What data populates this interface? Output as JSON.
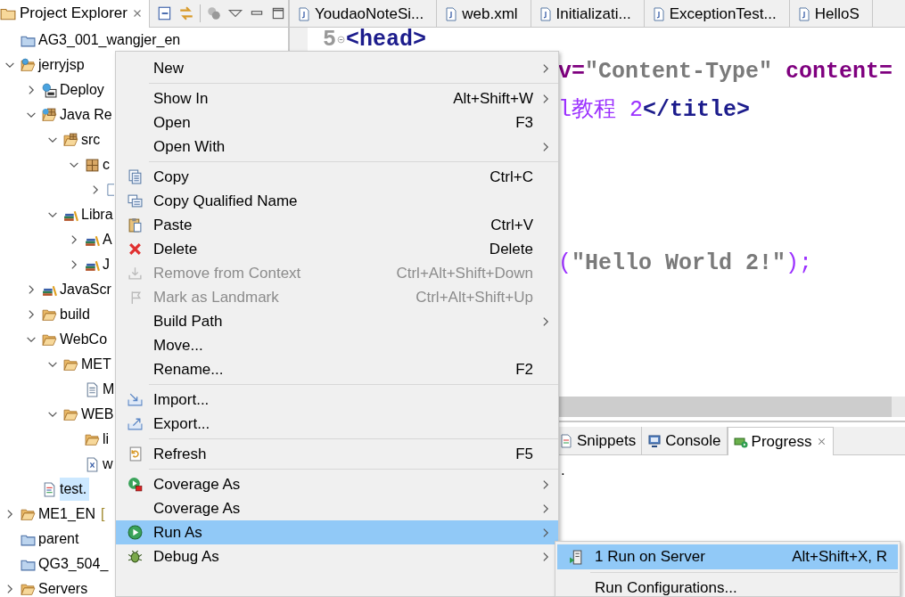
{
  "explorer": {
    "title": "Project Explorer",
    "tree": [
      {
        "label": "AG3_001_wangjer_en",
        "kind": "project",
        "selected": false
      },
      {
        "label": "jerryjsp",
        "kind": "web-project",
        "expanded": true,
        "selected": false,
        "children": [
          {
            "label": "Deploy",
            "kind": "deploy",
            "expanded": false,
            "selected": false
          },
          {
            "label": "Java Re",
            "kind": "resources",
            "expanded": true,
            "selected": false,
            "children": [
              {
                "label": "src",
                "kind": "source",
                "expanded": true,
                "selected": false,
                "children": [
                  {
                    "label": "c",
                    "kind": "package",
                    "expanded": true,
                    "selected": false,
                    "children": [
                      {
                        "kind": "class",
                        "expanded": false,
                        "selected": false
                      }
                    ]
                  }
                ]
              },
              {
                "label": "Libra",
                "kind": "library",
                "expanded": true,
                "selected": false,
                "children": [
                  {
                    "label": "A",
                    "kind": "library",
                    "expanded": false,
                    "selected": false
                  },
                  {
                    "label": "J",
                    "kind": "library",
                    "expanded": false,
                    "selected": false
                  }
                ]
              }
            ]
          },
          {
            "label": "JavaScr",
            "kind": "library",
            "expanded": false,
            "selected": false
          },
          {
            "label": "build",
            "kind": "folder",
            "expanded": false,
            "selected": false
          },
          {
            "label": "WebCo",
            "kind": "folder",
            "expanded": true,
            "selected": false,
            "children": [
              {
                "label": "MET",
                "kind": "folder",
                "expanded": true,
                "selected": false,
                "children": [
                  {
                    "label": "M",
                    "kind": "file",
                    "selected": false
                  }
                ]
              },
              {
                "label": "WEB",
                "kind": "folder",
                "expanded": true,
                "selected": false,
                "children": [
                  {
                    "label": "li",
                    "kind": "folder",
                    "selected": false
                  },
                  {
                    "label": "w",
                    "kind": "xml",
                    "selected": false
                  }
                ]
              }
            ]
          },
          {
            "label": "test.",
            "kind": "jsp",
            "selected": true
          }
        ]
      },
      {
        "label": "ME1_EN",
        "decoration": "[",
        "kind": "folder",
        "expanded": false,
        "selected": false
      },
      {
        "label": "parent",
        "kind": "project",
        "selected": false
      },
      {
        "label": "QG3_504_",
        "kind": "project",
        "selected": false
      },
      {
        "label": "Servers",
        "kind": "folder",
        "expanded": false,
        "selected": false
      }
    ]
  },
  "editor": {
    "tabs": [
      {
        "label": "YoudaoNoteSi...",
        "selected": false
      },
      {
        "label": "web.xml",
        "selected": false
      },
      {
        "label": "Initializati...",
        "selected": false
      },
      {
        "label": "ExceptionTest...",
        "selected": false
      },
      {
        "label": "HelloS",
        "selected": false
      }
    ],
    "lines": [
      {
        "number": "5",
        "tokens": [
          {
            "kind": "tag",
            "text": "<head>"
          }
        ]
      },
      {
        "tokens": [
          {
            "kind": "attr",
            "text": "v="
          },
          {
            "kind": "string",
            "text": "\"Content-Type\""
          },
          {
            "kind": "attr",
            "text": " content="
          }
        ]
      },
      {
        "tokens": [
          {
            "kind": "text",
            "text": "l教程 2"
          },
          {
            "kind": "tag",
            "text": "</title>"
          }
        ]
      },
      {
        "tokens": [
          {
            "kind": "text",
            "text": "("
          },
          {
            "kind": "string",
            "text": "\"Hello World 2!\""
          },
          {
            "kind": "text",
            "text": ");"
          }
        ]
      }
    ]
  },
  "bottom_panel": {
    "tabs": [
      {
        "label": "Snippets",
        "selected": false
      },
      {
        "label": "Console",
        "selected": false
      },
      {
        "label": "Progress",
        "selected": true
      }
    ],
    "text": "."
  },
  "context_menu": {
    "groups": [
      {
        "items": [
          {
            "label": "New",
            "submenu": true,
            "disabled": false,
            "selected": false
          }
        ]
      },
      {
        "items": [
          {
            "label": "Show In",
            "shortcut": "Alt+Shift+W",
            "submenu": true,
            "disabled": false,
            "selected": false
          },
          {
            "label": "Open",
            "shortcut": "F3",
            "submenu": false,
            "disabled": false,
            "selected": false
          },
          {
            "label": "Open With",
            "submenu": true,
            "disabled": false,
            "selected": false
          }
        ]
      },
      {
        "items": [
          {
            "label": "Copy",
            "shortcut": "Ctrl+C",
            "submenu": false,
            "disabled": false,
            "selected": false
          },
          {
            "label": "Copy Qualified Name",
            "submenu": false,
            "disabled": false,
            "selected": false
          },
          {
            "label": "Paste",
            "shortcut": "Ctrl+V",
            "submenu": false,
            "disabled": false,
            "selected": false
          },
          {
            "label": "Delete",
            "shortcut": "Delete",
            "submenu": false,
            "disabled": false,
            "selected": false
          },
          {
            "label": "Remove from Context",
            "shortcut": "Ctrl+Alt+Shift+Down",
            "submenu": false,
            "disabled": true,
            "selected": false
          },
          {
            "label": "Mark as Landmark",
            "shortcut": "Ctrl+Alt+Shift+Up",
            "submenu": false,
            "disabled": true,
            "selected": false
          },
          {
            "label": "Build Path",
            "submenu": true,
            "disabled": false,
            "selected": false
          },
          {
            "label": "Move...",
            "submenu": false,
            "disabled": false,
            "selected": false
          },
          {
            "label": "Rename...",
            "shortcut": "F2",
            "submenu": false,
            "disabled": false,
            "selected": false
          }
        ]
      },
      {
        "items": [
          {
            "label": "Import...",
            "submenu": false,
            "disabled": false,
            "selected": false
          },
          {
            "label": "Export...",
            "submenu": false,
            "disabled": false,
            "selected": false
          }
        ]
      },
      {
        "items": [
          {
            "label": "Refresh",
            "shortcut": "F5",
            "submenu": false,
            "disabled": false,
            "selected": false
          }
        ]
      },
      {
        "items": [
          {
            "label": "Coverage As",
            "submenu": true,
            "disabled": false,
            "selected": false
          },
          {
            "label": "Coverage As",
            "submenu": true,
            "disabled": false,
            "selected": false
          },
          {
            "label": "Run As",
            "submenu": true,
            "disabled": false,
            "selected": true
          },
          {
            "label": "Debug As",
            "submenu": true,
            "disabled": false,
            "selected": false
          }
        ]
      }
    ]
  },
  "submenu": {
    "groups": [
      {
        "items": [
          {
            "label": "1 Run on Server",
            "shortcut": "Alt+Shift+X, R",
            "selected": true
          }
        ]
      },
      {
        "items": [
          {
            "label": "Run Configurations...",
            "selected": false
          }
        ]
      }
    ]
  }
}
